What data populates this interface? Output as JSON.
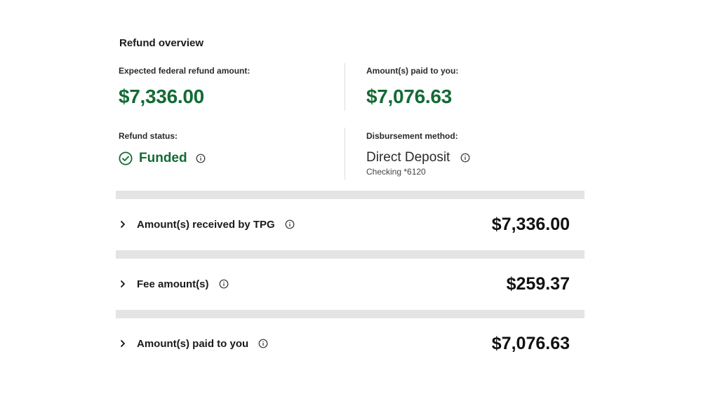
{
  "overview": {
    "title": "Refund overview",
    "expected_label": "Expected federal refund amount:",
    "expected_value": "$7,336.00",
    "paid_label": "Amount(s) paid to you:",
    "paid_value": "$7,076.63",
    "status_label": "Refund status:",
    "status_value": "Funded",
    "disbursement_label": "Disbursement method:",
    "disbursement_value": "Direct Deposit",
    "disbursement_account": "Checking *6120"
  },
  "rows": [
    {
      "label": "Amount(s) received by TPG",
      "amount": "$7,336.00"
    },
    {
      "label": "Fee amount(s)",
      "amount": "$259.37"
    },
    {
      "label": "Amount(s) paid to you",
      "amount": "$7,076.63"
    }
  ],
  "icons": {
    "status": "check-circle-icon",
    "info": "info-icon",
    "expand": "chevron-right-icon"
  },
  "colors": {
    "accent_green": "#136b35",
    "divider_bar": "#e4e4e4"
  }
}
